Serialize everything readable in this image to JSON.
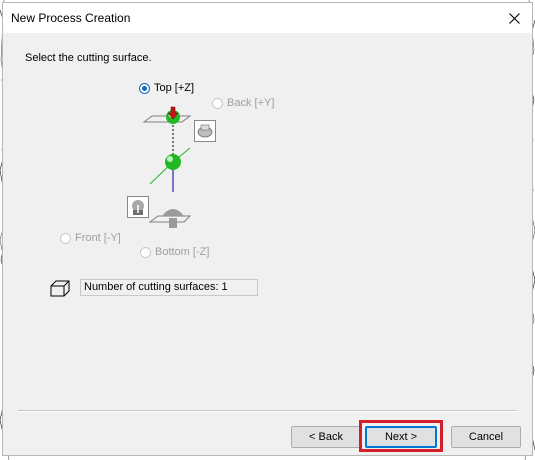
{
  "window": {
    "title": "New Process Creation"
  },
  "instruction": "Select the cutting surface.",
  "surfaces": {
    "top": {
      "label": "Top [+Z]",
      "selected": true
    },
    "back": {
      "label": "Back [+Y]",
      "enabled": false
    },
    "front": {
      "label": "Front [-Y]",
      "enabled": false
    },
    "bottom": {
      "label": "Bottom [-Z]",
      "enabled": false
    }
  },
  "count_field": {
    "text": "Number of cutting surfaces: 1"
  },
  "buttons": {
    "back": "< Back",
    "next": "Next >",
    "cancel": "Cancel"
  },
  "colors": {
    "sphere": "#22b822",
    "axis": "#0000a0",
    "arrow": "#c8141e",
    "highlight": "#d3202b",
    "radio_checked": "#0f67c7"
  },
  "icons": [
    "close-icon",
    "top-view-icon",
    "back-view-icon",
    "front-view-icon",
    "bottom-view-icon",
    "cube-icon"
  ]
}
